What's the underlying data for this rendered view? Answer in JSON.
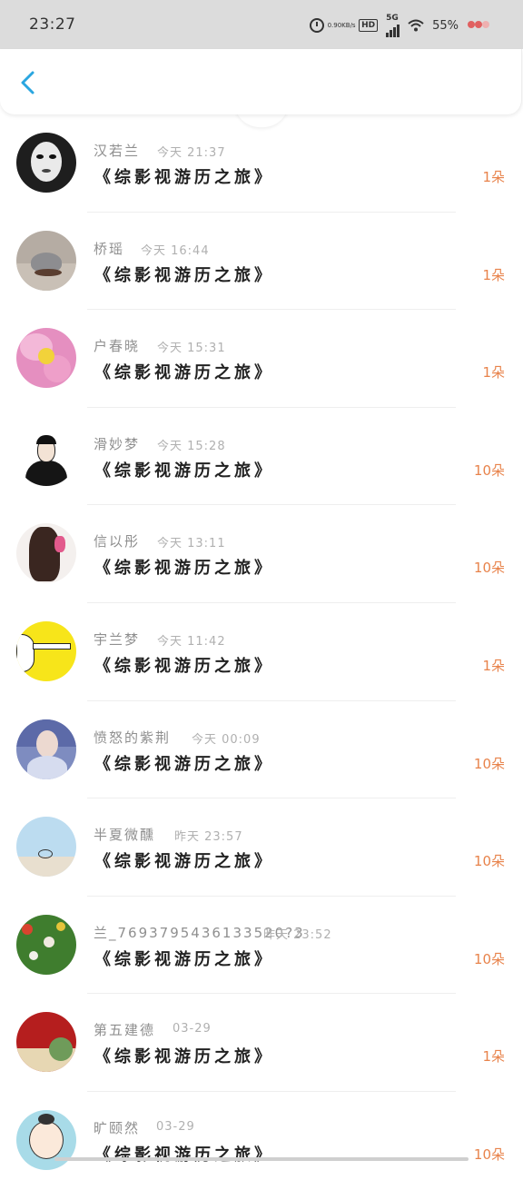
{
  "status_bar": {
    "time": "23:27",
    "net_speed_value": "0.90",
    "net_speed_unit": "KB/s",
    "hd_label": "HD",
    "network_label": "5G",
    "battery_percent": "55%",
    "icons": [
      "alarm-icon",
      "hd-icon",
      "signal-icon",
      "wifi-icon",
      "battery-icon"
    ]
  },
  "nav": {
    "back_icon": "chevron-left-icon",
    "accent": "#2aa6e0"
  },
  "items": [
    {
      "name": "汉若兰",
      "time": "今天 21:37",
      "title": "《综影视游历之旅》",
      "count": "1朵"
    },
    {
      "name": "桥瑶",
      "time": "今天 16:44",
      "title": "《综影视游历之旅》",
      "count": "1朵"
    },
    {
      "name": "户春晓",
      "time": "今天 15:31",
      "title": "《综影视游历之旅》",
      "count": "1朵"
    },
    {
      "name": "滑妙梦",
      "time": "今天 15:28",
      "title": "《综影视游历之旅》",
      "count": "10朵"
    },
    {
      "name": "信以彤",
      "time": "今天 13:11",
      "title": "《综影视游历之旅》",
      "count": "10朵"
    },
    {
      "name": "宇兰梦",
      "time": "今天 11:42",
      "title": "《综影视游历之旅》",
      "count": "1朵"
    },
    {
      "name": "愤怒的紫荆",
      "time": "今天 00:09",
      "title": "《综影视游历之旅》",
      "count": "10朵"
    },
    {
      "name": "半夏微醺",
      "time": "昨天 23:57",
      "title": "《综影视游历之旅》",
      "count": "10朵"
    },
    {
      "name": "兰_7693795436133520?3",
      "time": "昨天 23:52",
      "title": "《综影视游历之旅》",
      "count": "10朵"
    },
    {
      "name": "第五建德",
      "time": "03-29",
      "title": "《综影视游历之旅》",
      "count": "1朵"
    },
    {
      "name": "旷颐然",
      "time": "03-29",
      "title": "《综影视游历之旅》",
      "count": "10朵"
    }
  ],
  "colors": {
    "count": "#e8834b",
    "name": "#8f8f8f",
    "time": "#b0b0b0",
    "title": "#222222"
  }
}
